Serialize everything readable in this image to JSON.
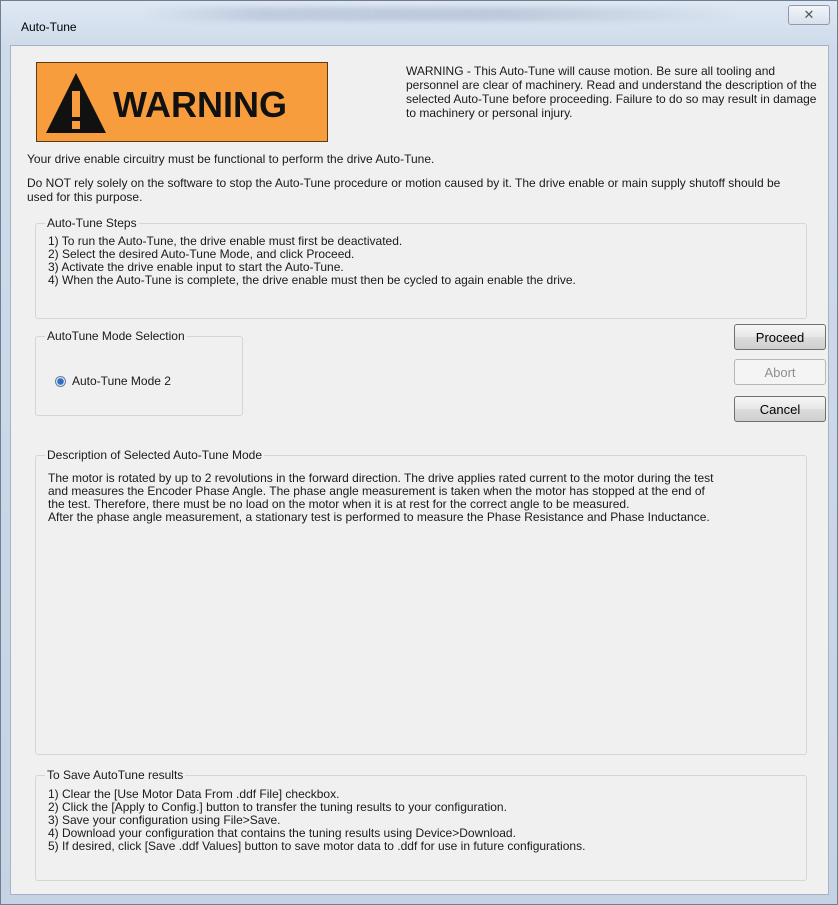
{
  "window": {
    "title": "Auto-Tune",
    "close_glyph": "✕"
  },
  "warning": {
    "sign_word": "WARNING",
    "text": "WARNING - This Auto-Tune will cause motion.  Be sure all tooling and personnel are clear of machinery.  Read and understand the description of the selected Auto-Tune before proceeding.  Failure to do so may result in damage to machinery or personal injury.",
    "sign_color": "#f79d3d"
  },
  "notices": {
    "line1": "Your drive enable circuitry must be functional to perform the drive Auto-Tune.",
    "line2": "Do NOT rely solely on the software to stop the Auto-Tune procedure or motion caused by it.  The drive enable or main supply shutoff should be used for this purpose."
  },
  "steps": {
    "title": "Auto-Tune Steps",
    "items": [
      "1) To run the Auto-Tune, the drive enable must first be deactivated.",
      "2) Select the desired Auto-Tune Mode, and click Proceed.",
      "3) Activate the drive enable input to start the Auto-Tune.",
      "4) When the Auto-Tune is complete, the drive enable must then be cycled to again enable the drive."
    ]
  },
  "mode_selection": {
    "title": "AutoTune Mode Selection",
    "option_label": "Auto-Tune Mode 2",
    "selected": true
  },
  "buttons": {
    "proceed": "Proceed",
    "abort": "Abort",
    "cancel": "Cancel"
  },
  "description": {
    "title": "Description of Selected Auto-Tune Mode",
    "text_lines": [
      "The motor is rotated by up to 2 revolutions in the forward direction.  The drive applies rated current to the motor during the test",
      "and measures the Encoder Phase Angle.  The phase angle measurement is taken when the motor has stopped at the end of",
      "the test.  Therefore, there must be no load on the motor when it is at rest for the correct angle to be measured.",
      "After the phase angle measurement, a stationary test is performed to measure the Phase Resistance and Phase Inductance."
    ]
  },
  "save_results": {
    "title": "To Save AutoTune results",
    "items": [
      "1) Clear the [Use Motor Data From .ddf File] checkbox.",
      "2) Click the [Apply to Config.] button to transfer the tuning results to your configuration.",
      "3) Save your configuration using File>Save.",
      "4) Download your configuration that contains the tuning results using Device>Download.",
      "5) If desired, click [Save .ddf Values] button to save motor data to .ddf for use in future configurations."
    ]
  }
}
